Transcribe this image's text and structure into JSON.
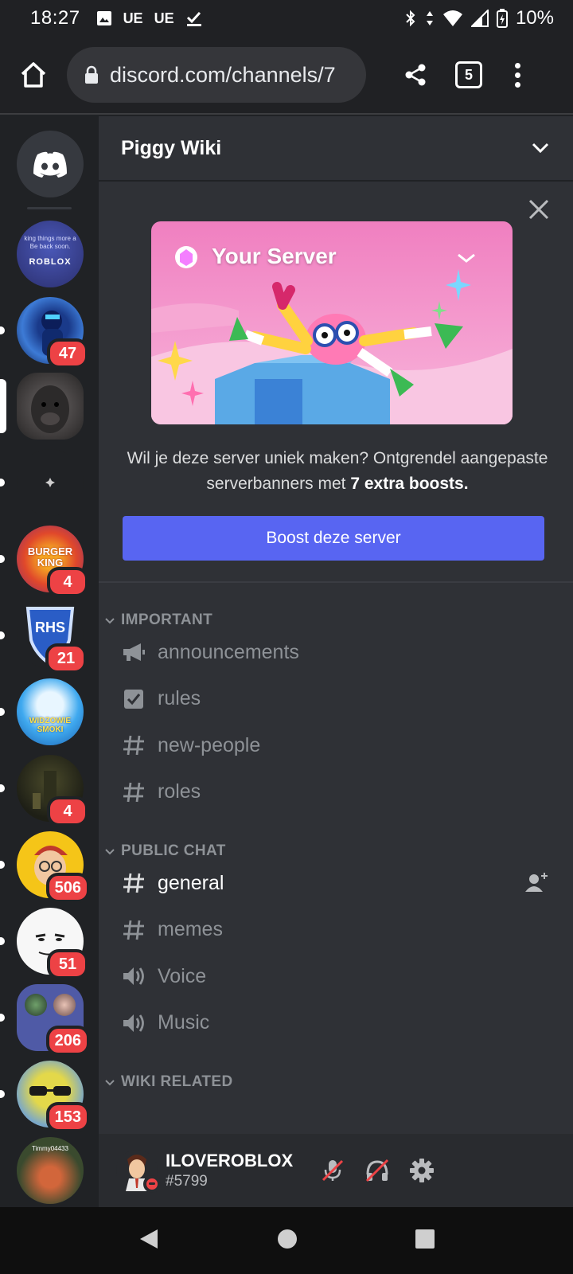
{
  "status_bar": {
    "time": "18:27",
    "left_icons": [
      "image-icon",
      "UE",
      "UE",
      "check-icon"
    ],
    "battery": "10%"
  },
  "browser": {
    "url": "discord.com/channels/7",
    "tab_count": "5"
  },
  "servers": [
    {
      "name": "roblox-server",
      "badge": ""
    },
    {
      "name": "server-2",
      "badge": "47"
    },
    {
      "name": "server-3",
      "badge": ""
    },
    {
      "name": "server-4",
      "badge": ""
    },
    {
      "name": "burger-king",
      "badge": "4"
    },
    {
      "name": "rhs",
      "badge": "21"
    },
    {
      "name": "server-7",
      "badge": ""
    },
    {
      "name": "server-8",
      "badge": "4"
    },
    {
      "name": "server-9",
      "badge": "506"
    },
    {
      "name": "server-10",
      "badge": "51"
    },
    {
      "name": "server-folder",
      "badge": "206"
    },
    {
      "name": "server-12",
      "badge": "153"
    },
    {
      "name": "server-13",
      "badge": ""
    }
  ],
  "server_icon_text": {
    "roblox_line1": "king things more a",
    "roblox_line2": "Be back soon.",
    "roblox_logo": "ROBLOX",
    "burger_king": "BURGER KING",
    "rhs": "RHS",
    "server7": "WIDZOWIE SMOKI",
    "server13": "Timmy04433"
  },
  "server": {
    "name": "Piggy Wiki"
  },
  "boost": {
    "banner_title": "Your Server",
    "text_pre": "Wil je deze server uniek maken? Ontgrendel aangepaste serverbanners met ",
    "text_bold": "7 extra boosts.",
    "button": "Boost deze server"
  },
  "categories": [
    {
      "name": "IMPORTANT",
      "channels": [
        {
          "name": "announcements",
          "icon": "announcement-icon"
        },
        {
          "name": "rules",
          "icon": "rules-icon"
        },
        {
          "name": "new-people",
          "icon": "hash-icon"
        },
        {
          "name": "roles",
          "icon": "hash-icon"
        }
      ]
    },
    {
      "name": "PUBLIC CHAT",
      "channels": [
        {
          "name": "general",
          "icon": "hash-icon"
        },
        {
          "name": "memes",
          "icon": "hash-icon"
        },
        {
          "name": "Voice",
          "icon": "speaker-icon"
        },
        {
          "name": "Music",
          "icon": "speaker-icon"
        }
      ]
    },
    {
      "name": "WIKI RELATED",
      "channels": []
    }
  ],
  "user": {
    "name": "ILOVEROBLOX",
    "tag": "#5799"
  },
  "colors": {
    "blurple": "#5865f2",
    "badge_red": "#ed4245",
    "rail_bg": "#202225",
    "panel_bg": "#2f3136"
  }
}
